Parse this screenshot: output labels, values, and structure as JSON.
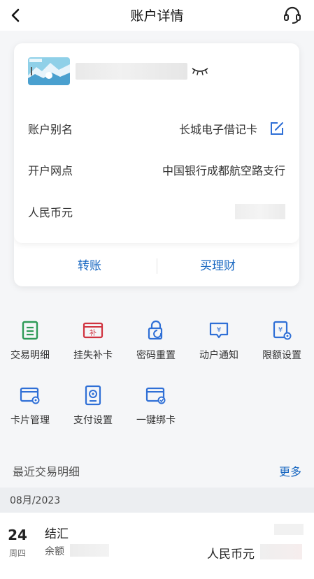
{
  "header": {
    "title": "账户详情",
    "back_icon": "chevron-left-icon",
    "support_icon": "headset-icon"
  },
  "card": {
    "alias_label": "账户别名",
    "alias_value": "长城电子借记卡",
    "branch_label": "开户网点",
    "branch_value": "中国银行成都航空路支行",
    "currency_label": "人民币元",
    "transfer_label": "转账",
    "wealth_label": "买理财"
  },
  "services": [
    {
      "label": "交易明细",
      "icon": "transaction-list-icon",
      "color": "#2e9a57"
    },
    {
      "label": "挂失补卡",
      "icon": "report-loss-icon",
      "color": "#d0323f"
    },
    {
      "label": "密码重置",
      "icon": "password-reset-icon",
      "color": "#2f6fd6"
    },
    {
      "label": "动户通知",
      "icon": "account-notify-icon",
      "color": "#2f6fd6"
    },
    {
      "label": "限额设置",
      "icon": "limit-settings-icon",
      "color": "#2f6fd6"
    },
    {
      "label": "卡片管理",
      "icon": "card-management-icon",
      "color": "#2f6fd6"
    },
    {
      "label": "支付设置",
      "icon": "payment-settings-icon",
      "color": "#2f6fd6"
    },
    {
      "label": "一键绑卡",
      "icon": "bind-card-icon",
      "color": "#2f6fd6"
    }
  ],
  "recent": {
    "title": "最近交易明细",
    "more": "更多",
    "month": "08月/2023",
    "transactions": [
      {
        "day": "24",
        "weekday": "周四",
        "name": "结汇",
        "balance_label": "余额",
        "currency": "人民币元"
      }
    ]
  },
  "colors": {
    "accent": "#1565c0",
    "green": "#2e9a57",
    "red": "#d0323f",
    "blue": "#2f6fd6"
  }
}
